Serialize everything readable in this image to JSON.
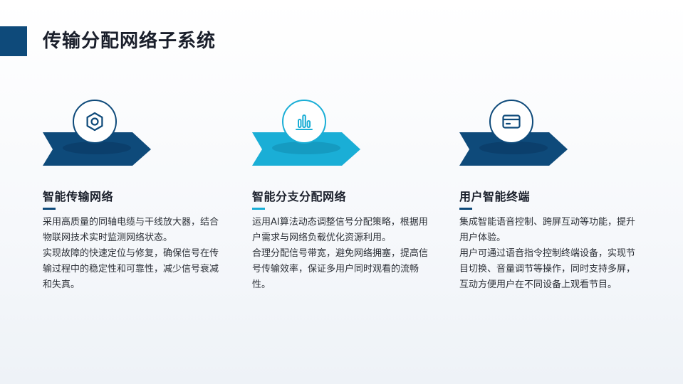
{
  "page": {
    "title": "传输分配网络子系统"
  },
  "colors": {
    "primary": "#0e4a7a",
    "accent": "#1aaed6",
    "heading": "#1a1f2b",
    "text": "#2b2f36"
  },
  "cards": [
    {
      "icon": "hexagon-nut-icon",
      "heading": "智能传输网络",
      "paragraphs": [
        "采用高质量的同轴电缆与干线放大器，结合物联网技术实时监测网络状态。",
        "实现故障的快速定位与修复，确保信号在传输过程中的稳定性和可靠性，减少信号衰减和失真。"
      ]
    },
    {
      "icon": "bar-chart-icon",
      "heading": "智能分支分配网络",
      "paragraphs": [
        "运用AI算法动态调整信号分配策略，根据用户需求与网络负载优化资源利用。",
        "合理分配信号带宽，避免网络拥塞，提高信号传输效率，保证多用户同时观看的流畅性。"
      ]
    },
    {
      "icon": "credit-card-icon",
      "heading": "用户智能终端",
      "paragraphs": [
        "集成智能语音控制、跨屏互动等功能，提升用户体验。",
        "用户可通过语音指令控制终端设备，实现节目切换、音量调节等操作，同时支持多屏，互动方便用户在不同设备上观看节目。"
      ]
    }
  ]
}
